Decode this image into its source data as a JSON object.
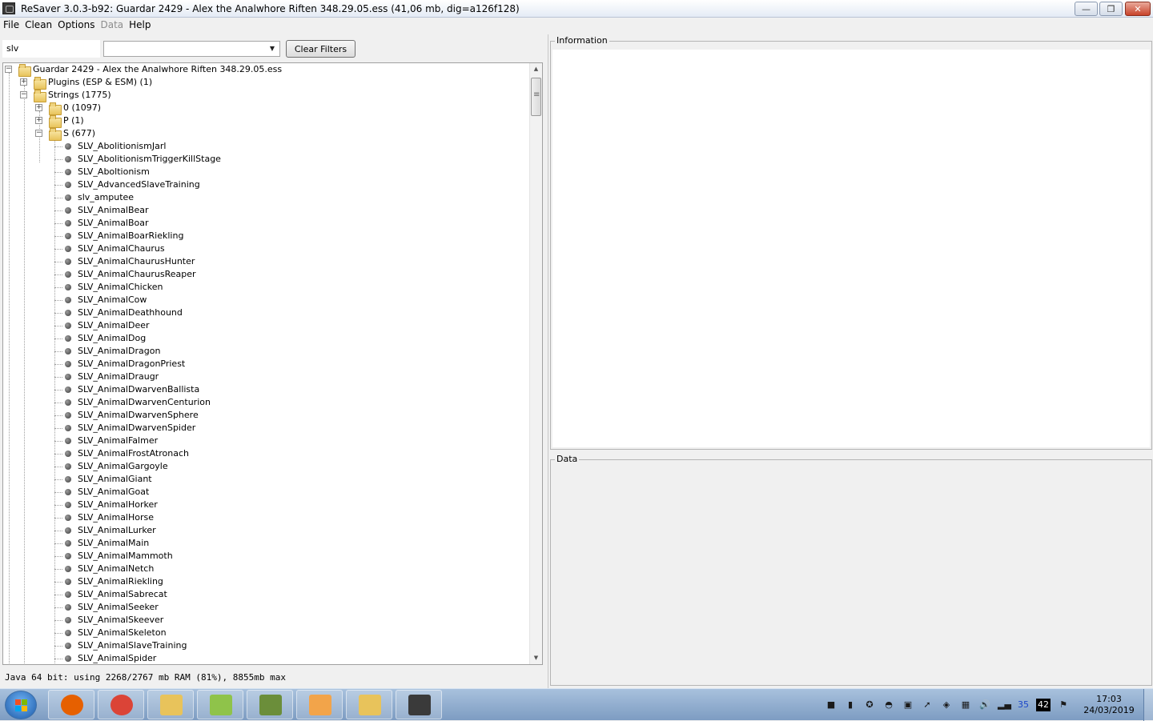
{
  "window": {
    "title": "ReSaver 3.0.3-b92: Guardar 2429 - Alex the Analwhore  Riften  348.29.05.ess (41,06 mb, dig=a126f128)",
    "controls": {
      "minimize": "—",
      "maximize": "❐",
      "close": "✕"
    }
  },
  "menu": [
    {
      "label": "File",
      "enabled": true
    },
    {
      "label": "Clean",
      "enabled": true
    },
    {
      "label": "Options",
      "enabled": true
    },
    {
      "label": "Data",
      "enabled": false
    },
    {
      "label": "Help",
      "enabled": true
    }
  ],
  "filter": {
    "text": "slv",
    "combo_value": "",
    "clear_label": "Clear Filters"
  },
  "tree": {
    "root": {
      "label": "Guardar 2429 - Alex the Analwhore  Riften  348.29.05.ess",
      "expanded": true
    },
    "nodes": [
      {
        "label": "Plugins (ESP & ESM) (1)",
        "expanded": false
      },
      {
        "label": "Strings (1775)",
        "expanded": true
      },
      {
        "label": "0 (1097)",
        "expanded": false
      },
      {
        "label": "P (1)",
        "expanded": false
      },
      {
        "label": "S (677)",
        "expanded": true
      }
    ],
    "leaves": [
      "SLV_AbolitionismJarl",
      "SLV_AbolitionismTriggerKillStage",
      "SLV_Aboltionism",
      "SLV_AdvancedSlaveTraining",
      "slv_amputee",
      "SLV_AnimalBear",
      "SLV_AnimalBoar",
      "SLV_AnimalBoarRiekling",
      "SLV_AnimalChaurus",
      "SLV_AnimalChaurusHunter",
      "SLV_AnimalChaurusReaper",
      "SLV_AnimalChicken",
      "SLV_AnimalCow",
      "SLV_AnimalDeathhound",
      "SLV_AnimalDeer",
      "SLV_AnimalDog",
      "SLV_AnimalDragon",
      "SLV_AnimalDragonPriest",
      "SLV_AnimalDraugr",
      "SLV_AnimalDwarvenBallista",
      "SLV_AnimalDwarvenCenturion",
      "SLV_AnimalDwarvenSphere",
      "SLV_AnimalDwarvenSpider",
      "SLV_AnimalFalmer",
      "SLV_AnimalFrostAtronach",
      "SLV_AnimalGargoyle",
      "SLV_AnimalGiant",
      "SLV_AnimalGoat",
      "SLV_AnimalHorker",
      "SLV_AnimalHorse",
      "SLV_AnimalLurker",
      "SLV_AnimalMain",
      "SLV_AnimalMammoth",
      "SLV_AnimalNetch",
      "SLV_AnimalRiekling",
      "SLV_AnimalSabrecat",
      "SLV_AnimalSeeker",
      "SLV_AnimalSkeever",
      "SLV_AnimalSkeleton",
      "SLV_AnimalSlaveTraining",
      "SLV_AnimalSpider"
    ]
  },
  "status": "Java 64 bit: using 2268/2767 mb RAM (81%), 8855mb max",
  "panels": {
    "information_title": "Information",
    "data_title": "Data"
  },
  "taskbar": {
    "apps": [
      {
        "name": "firefox-icon",
        "color": "#e66000"
      },
      {
        "name": "chrome-icon",
        "color": "#db4437"
      },
      {
        "name": "explorer-icon",
        "color": "#e8c35b"
      },
      {
        "name": "notepadpp-icon",
        "color": "#8fc34a"
      },
      {
        "name": "minecraft-icon",
        "color": "#6b8e3a"
      },
      {
        "name": "app-icon",
        "color": "#f2a44a"
      },
      {
        "name": "explorer-icon",
        "color": "#e8c35b"
      },
      {
        "name": "resaver-icon",
        "color": "#3a3a3a"
      }
    ],
    "tray": [
      {
        "name": "nvidia-icon",
        "glyph": "■"
      },
      {
        "name": "green-app-icon",
        "glyph": "▮"
      },
      {
        "name": "avast-icon",
        "glyph": "✪"
      },
      {
        "name": "tray-app-icon",
        "glyph": "◓"
      },
      {
        "name": "monitor-icon",
        "glyph": "▣"
      },
      {
        "name": "pointer-icon",
        "glyph": "➚"
      },
      {
        "name": "shield-icon",
        "glyph": "◈"
      },
      {
        "name": "network-icon",
        "glyph": "▦"
      },
      {
        "name": "volume-icon",
        "glyph": "🔊"
      },
      {
        "name": "signal-icon",
        "glyph": "▂▄"
      },
      {
        "name": "temp-icon",
        "glyph": "35"
      },
      {
        "name": "temp2-icon",
        "glyph": "42"
      },
      {
        "name": "flag-icon",
        "glyph": "⚑"
      }
    ],
    "time": "17:03",
    "date": "24/03/2019"
  }
}
